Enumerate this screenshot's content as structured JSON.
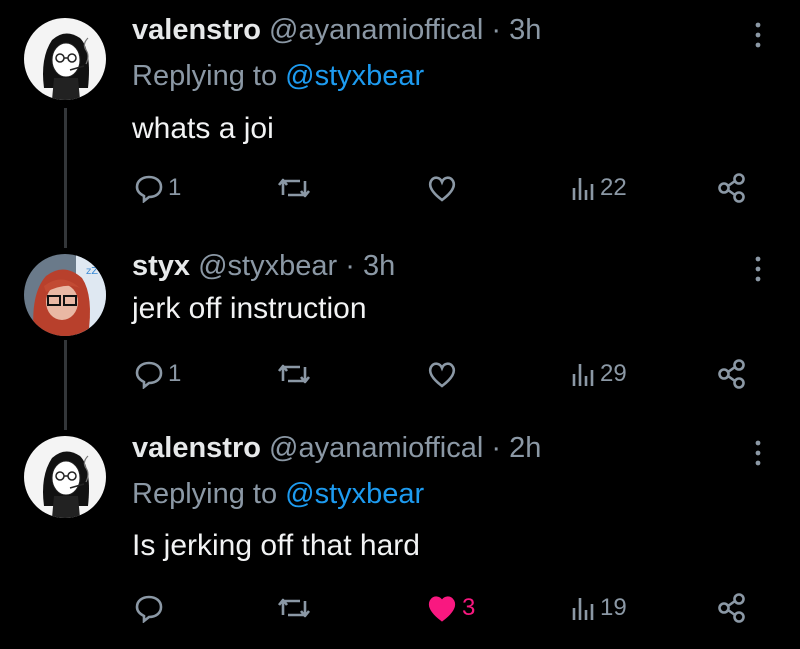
{
  "tweets": [
    {
      "name": "valenstro",
      "handle": "@ayanamioffical",
      "separator": "·",
      "time": "3h",
      "replying_prefix": "Replying to",
      "replying_to": "@styxbear",
      "text": "whats a joi",
      "replies": "1",
      "retweets": "",
      "likes": "",
      "views": "22",
      "liked": false
    },
    {
      "name": "styx",
      "handle": "@styxbear",
      "separator": "·",
      "time": "3h",
      "text": "jerk off instruction",
      "replies": "1",
      "retweets": "",
      "likes": "",
      "views": "29",
      "liked": false
    },
    {
      "name": "valenstro",
      "handle": "@ayanamioffical",
      "separator": "·",
      "time": "2h",
      "replying_prefix": "Replying to",
      "replying_to": "@styxbear",
      "text": "Is jerking off that hard",
      "replies": "",
      "retweets": "",
      "likes": "3",
      "views": "19",
      "liked": true
    }
  ],
  "colors": {
    "background": "#000000",
    "text": "#e7e9ea",
    "secondary": "#8b98a5",
    "mention": "#1d9bf0",
    "like_active": "#f91880",
    "thread_line": "#333639"
  },
  "icons": [
    "reply-icon",
    "retweet-icon",
    "like-icon",
    "views-icon",
    "share-icon",
    "more-icon"
  ]
}
